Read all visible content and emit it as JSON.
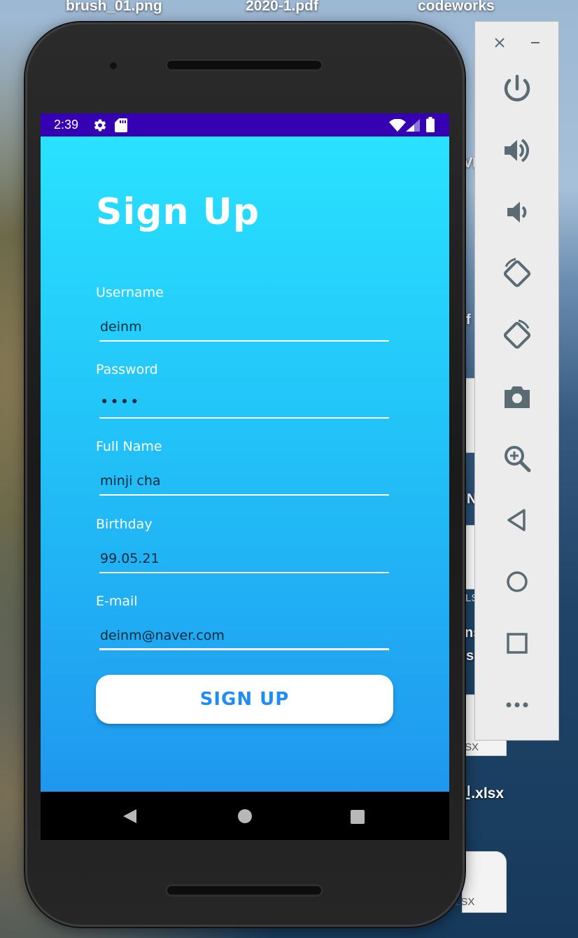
{
  "desktop": {
    "labels": [
      "brush_01.png",
      "2020-1.pdf",
      "codeworks",
      "인.xlsx"
    ],
    "fragments": [
      "VE",
      "f",
      "N",
      "LS",
      "ns",
      "s",
      "SX",
      "LSX"
    ]
  },
  "status_bar": {
    "time": "2:39"
  },
  "signup": {
    "title": "Sign Up",
    "fields": [
      {
        "label": "Username",
        "value": "deinm"
      },
      {
        "label": "Password",
        "value": "••••"
      },
      {
        "label": "Full Name",
        "value": "minji cha"
      },
      {
        "label": "Birthday",
        "value": "99.05.21"
      },
      {
        "label": "E-mail",
        "value": "deinm@naver.com"
      }
    ],
    "button_label": "SIGN UP"
  },
  "emulator_panel": {
    "tools": [
      "power-icon",
      "volume-up-icon",
      "volume-down-icon",
      "rotate-left-icon",
      "rotate-right-icon",
      "camera-icon",
      "zoom-icon",
      "back-icon",
      "home-icon",
      "overview-icon",
      "more-icon"
    ]
  },
  "colors": {
    "status_bar": "#3600b3",
    "gradient_top": "#29e2ff",
    "gradient_bottom": "#1f97ef",
    "button_text": "#1e8ef0"
  }
}
